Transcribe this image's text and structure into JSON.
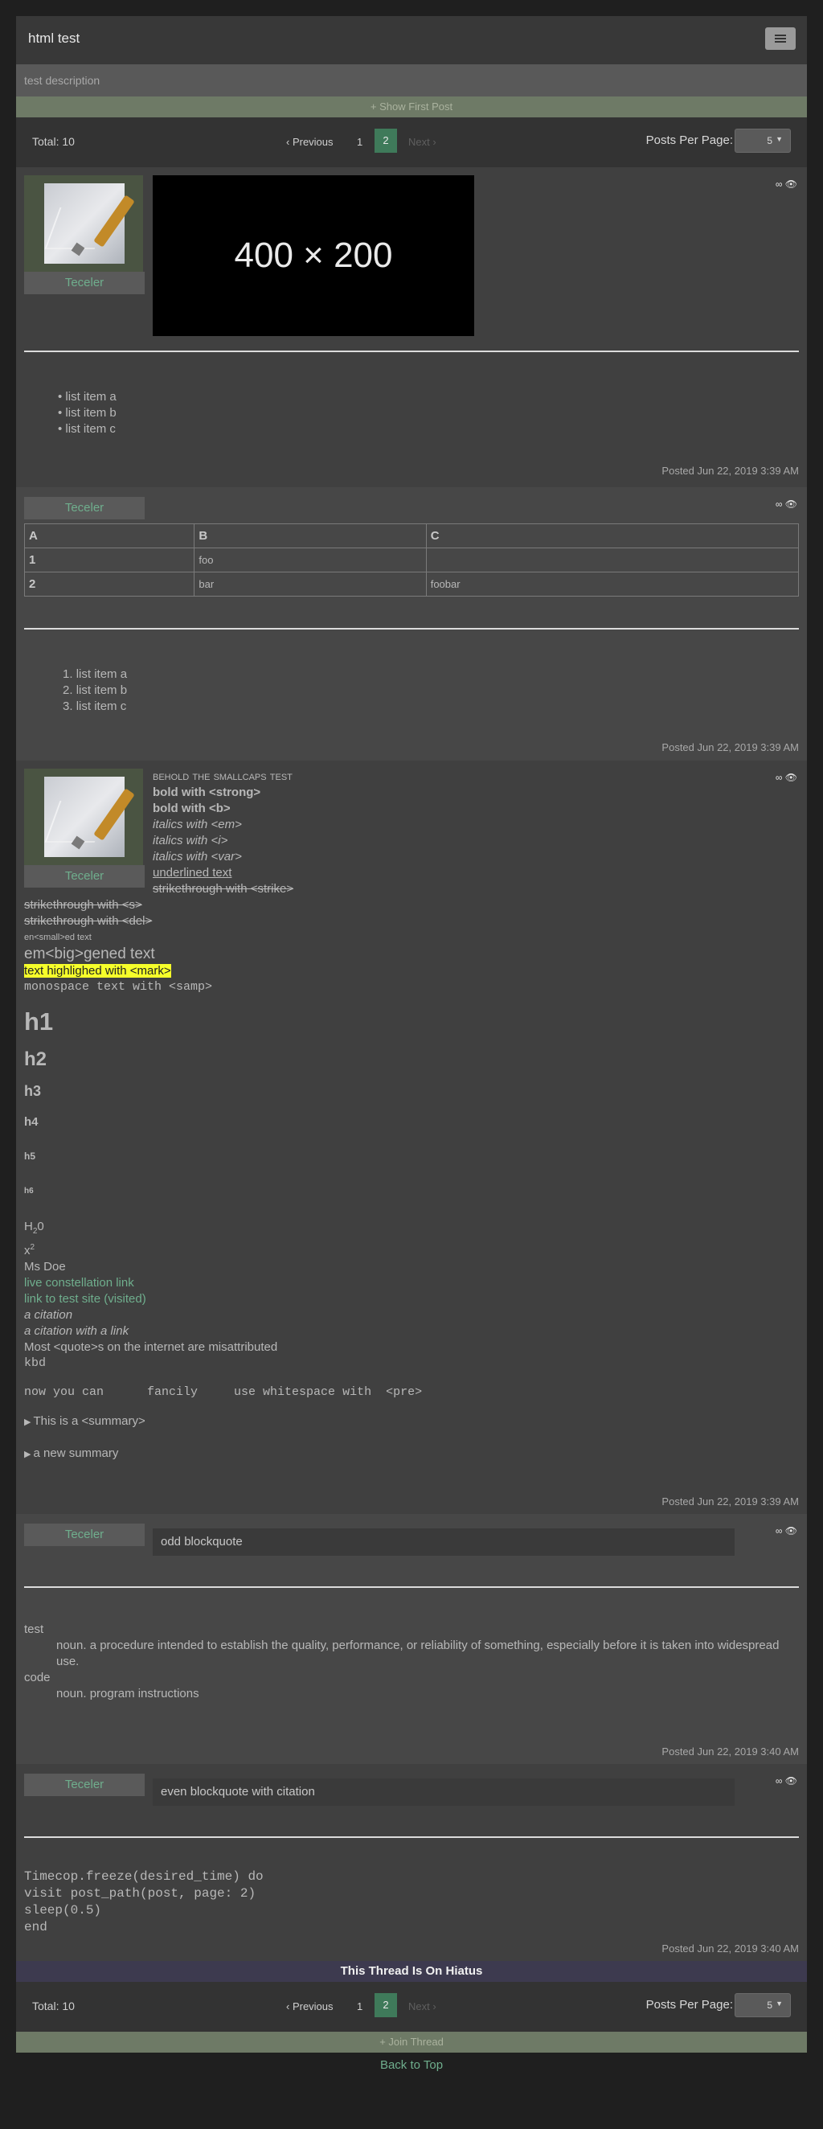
{
  "header": {
    "title": "html test"
  },
  "description": "test description",
  "show_first_post": "+ Show First Post",
  "pager": {
    "total": "Total: 10",
    "previous": "‹ Previous",
    "page1": "1",
    "page2": "2",
    "next": "Next ›",
    "per_page_label": "Posts Per Page:",
    "per_page_value": "5"
  },
  "icons": {
    "link": "∞",
    "eye": "👁"
  },
  "posts": [
    {
      "author": "Teceler",
      "image_label": "400 × 200",
      "list": [
        "list item a",
        "list item b",
        "list item c"
      ],
      "posted": "Posted Jun 22, 2019 3:39 AM"
    },
    {
      "author": "Teceler",
      "table": {
        "headers": [
          "A",
          "B",
          "C"
        ],
        "rows": [
          [
            "1",
            "foo",
            ""
          ],
          [
            "2",
            "bar",
            "foobar"
          ]
        ]
      },
      "list": [
        "list item a",
        "list item b",
        "list item c"
      ],
      "posted": "Posted Jun 22, 2019 3:39 AM"
    },
    {
      "author": "Teceler",
      "lines": {
        "smallcaps": "behold the smallcaps test",
        "strong": "bold with <strong>",
        "b": "bold with <b>",
        "em": "italics with <em>",
        "i": "italics with <i>",
        "var": "italics with <var>",
        "u": "underlined text",
        "strike": "strikethrough with <strike>",
        "s": "strikethrough with <s>",
        "del": "strikethrough with <del>",
        "small": "en<small>ed text",
        "big": "em<big>gened text",
        "mark": "text highlighed with <mark>",
        "samp": "monospace text with <samp>",
        "h1": "h1",
        "h2": "h2",
        "h3": "h3",
        "h4": "h4",
        "h5": "h5",
        "h6": "h6",
        "sub": "H",
        "sub2": "2",
        "sub3": "0",
        "sup": "x",
        "sup2": "2",
        "abbr": "Ms Doe",
        "link1": "live constellation link",
        "link2": "link to test site (visited)",
        "cite1": "a citation",
        "cite2": "a citation with a link",
        "quote": "Most <quote>s on the internet are misattributed",
        "kbd": "kbd",
        "pre": "now you can      fancily     use whitespace with  <pre>",
        "summary1": "This is a <summary>",
        "summary2": "a new summary"
      },
      "posted": "Posted Jun 22, 2019 3:39 AM"
    },
    {
      "author": "Teceler",
      "blockquote": "odd blockquote",
      "dl": [
        {
          "term": "test",
          "def": "noun. a procedure intended to establish the quality, performance, or reliability of something, especially before it is taken into widespread use."
        },
        {
          "term": "code",
          "def": "noun. program instructions"
        }
      ],
      "posted": "Posted Jun 22, 2019 3:40 AM"
    },
    {
      "author": "Teceler",
      "blockquote": "even blockquote with citation",
      "code": [
        "Timecop.freeze(desired_time) do",
        "visit post_path(post, page: 2)",
        "sleep(0.5)",
        "end"
      ],
      "posted": "Posted Jun 22, 2019 3:40 AM"
    }
  ],
  "hiatus": "This Thread Is On Hiatus",
  "join": "+ Join Thread",
  "back_to_top": "Back to Top"
}
